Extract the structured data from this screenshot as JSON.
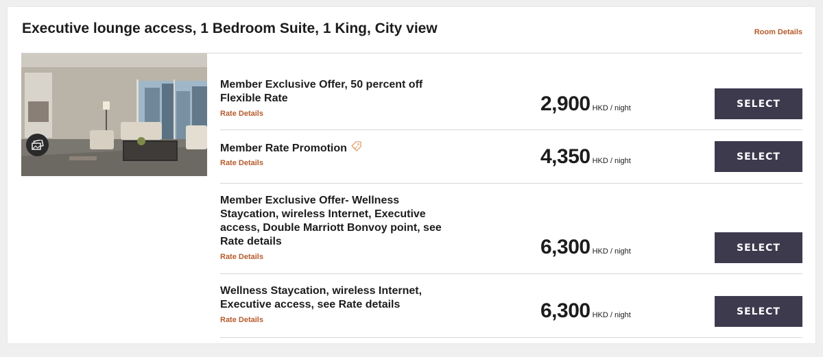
{
  "room": {
    "title": "Executive lounge access, 1 Bedroom Suite, 1 King, City view",
    "details_link": "Room Details"
  },
  "rates": [
    {
      "name": "Member Exclusive Offer, 50 percent off Flexible Rate",
      "details_link": "Rate Details",
      "price": "2,900",
      "unit": "HKD / night",
      "button": "SELECT",
      "has_tag_icon": false
    },
    {
      "name": "Member Rate Promotion",
      "details_link": "Rate Details",
      "price": "4,350",
      "unit": "HKD / night",
      "button": "SELECT",
      "has_tag_icon": true
    },
    {
      "name": "Member Exclusive Offer- Wellness Staycation, wireless Internet, Executive access, Double Marriott Bonvoy point, see Rate details",
      "details_link": "Rate Details",
      "price": "6,300",
      "unit": "HKD / night",
      "button": "SELECT",
      "has_tag_icon": false
    },
    {
      "name": "Wellness Staycation, wireless Internet, Executive access, see Rate details",
      "details_link": "Rate Details",
      "price": "6,300",
      "unit": "HKD / night",
      "button": "SELECT",
      "has_tag_icon": false
    }
  ],
  "icons": {
    "gallery": "gallery-icon",
    "tag": "tag-icon"
  },
  "colors": {
    "accent": "#b65a2b",
    "button_bg": "#3d3a4e",
    "button_text": "#ffffff",
    "divider": "#d6d6d6"
  }
}
